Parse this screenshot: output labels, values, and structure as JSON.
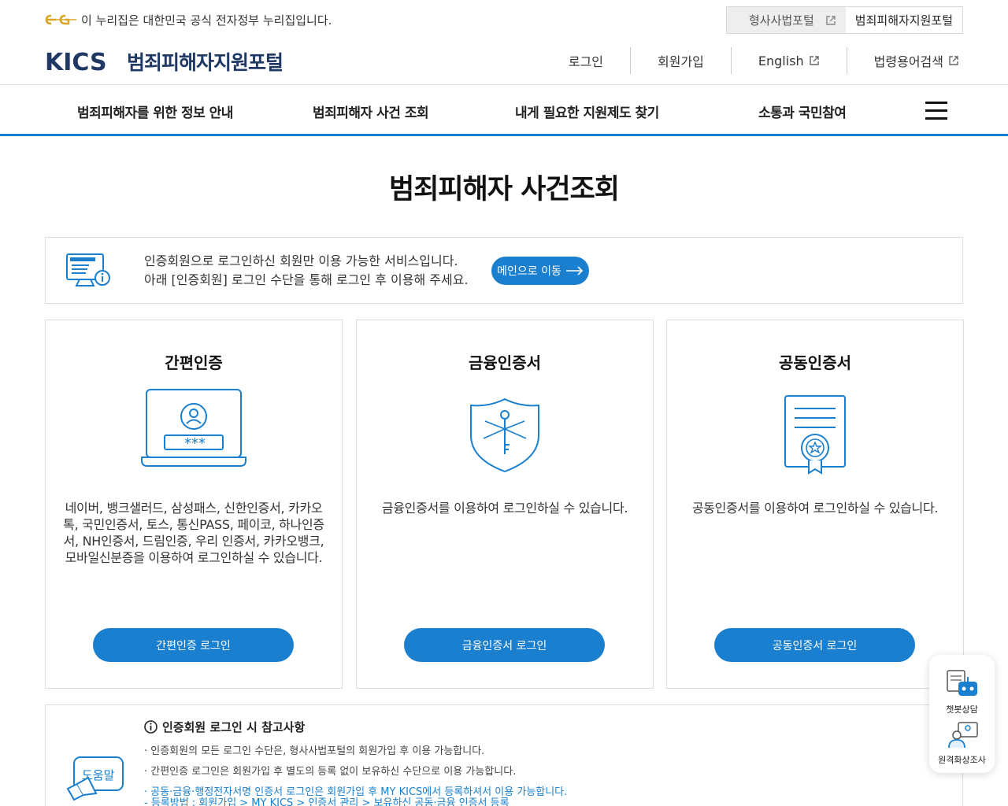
{
  "gov_bar": {
    "text": "이 누리집은 대한민국 공식 전자정부 누리집입니다."
  },
  "portals": [
    {
      "label": "형사사법포털"
    },
    {
      "label": "범죄피해자지원포털"
    }
  ],
  "header": {
    "logo_mark": "KICS",
    "logo_text": "범죄피해자지원포털",
    "util_nav": [
      "로그인",
      "회원가입",
      "English",
      "법령용어검색"
    ]
  },
  "gnb": [
    "범죄피해자를 위한 정보 안내",
    "범죄피해자 사건 조회",
    "내게 필요한 지원제도 찾기",
    "소통과 국민참여"
  ],
  "page_title": "범죄피해자 사건조회",
  "notice": {
    "line1": "인증회원으로 로그인하신 회원만 이용 가능한 서비스입니다.",
    "line2": "아래 [인증회원] 로그인 수단을 통해 로그인 후 이용해 주세요.",
    "button": "메인으로 이동"
  },
  "cards": [
    {
      "title": "간편인증",
      "desc": "네이버, 뱅크샐러드, 삼성패스, 신한인증서, 카카오톡, 국민인증서, 토스, 통신PASS, 페이코, 하나인증서, NH인증서, 드림인증, 우리 인증서, 카카오뱅크, 모바일신분증을 이용하여 로그인하실 수 있습니다.",
      "button": "간편인증 로그인",
      "password_mask": "***"
    },
    {
      "title": "금융인증서",
      "desc": "금융인증서를 이용하여 로그인하실 수 있습니다.",
      "button": "금융인증서 로그인"
    },
    {
      "title": "공동인증서",
      "desc": "공동인증서를 이용하여 로그인하실 수 있습니다.",
      "button": "공동인증서 로그인"
    }
  ],
  "help": {
    "badge": "도움말",
    "title": "인증회원 로그인 시 참고사항",
    "items": [
      "인증회원의 모든 로그인 수단은, 형사사법포털의 회원가입 후 이용 가능합니다.",
      "간편인증 로그인은 회원가입 후 별도의 등록 없이 보유하신 수단으로 이용 가능합니다.",
      "공동·금융·행정전자서명 인증서 로그인은 회원가입 후 MY KICS에서 등록하셔서 이용 가능합니다.",
      "- 등록방법 : 회원가입 > MY KICS > 인증서 관리 > 보유하신 공동·금융 인증서 등록"
    ]
  },
  "floating": [
    {
      "label": "챗봇상담"
    },
    {
      "label": "원격화상조사"
    }
  ],
  "colors": {
    "accent": "#1a7fce",
    "brand": "#1f3864",
    "gov_gold": "#d9a520"
  }
}
